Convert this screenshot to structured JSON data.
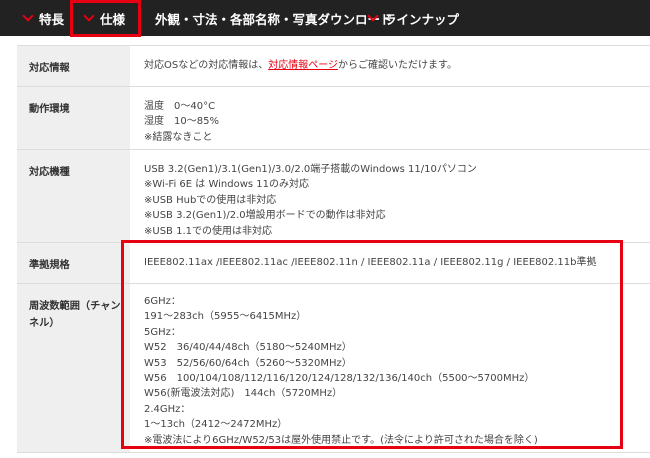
{
  "nav": {
    "tabs": [
      {
        "label": "特長"
      },
      {
        "label": "仕様"
      },
      {
        "label": "外観・寸法・各部名称・写真ダウンロード"
      },
      {
        "label": "ラインナップ"
      }
    ],
    "accent_color": "#e60012"
  },
  "spec": {
    "support": {
      "label": "対応情報",
      "text_before": "対応OSなどの対応情報は、",
      "link": "対応情報ページ",
      "text_after": "からご確認いただけます。"
    },
    "environment": {
      "label": "動作環境",
      "lines": [
        "温度　0～40°C",
        "湿度　10～85%",
        "※結露なきこと"
      ]
    },
    "devices": {
      "label": "対応機種",
      "lines": [
        "USB 3.2(Gen1)/3.1(Gen1)/3.0/2.0端子搭載のWindows 11/10パソコン",
        "※Wi-Fi 6E は Windows 11のみ対応",
        "※USB Hubでの使用は非対応",
        "※USB 3.2(Gen1)/2.0増設用ボードでの動作は非対応",
        "※USB 1.1での使用は非対応"
      ]
    },
    "standards": {
      "label": "準拠規格",
      "value": "IEEE802.11ax /IEEE802.11ac /IEEE802.11n / IEEE802.11a / IEEE802.11g / IEEE802.11b準拠"
    },
    "frequency": {
      "label": "周波数範囲（チャンネル）",
      "lines": [
        "6GHz：",
        "191～283ch（5955～6415MHz）",
        "5GHz：",
        "W52　36/40/44/48ch（5180～5240MHz）",
        "W53　52/56/60/64ch（5260～5320MHz）",
        "W56　100/104/108/112/116/120/124/128/132/136/140ch（5500～5700MHz）",
        "W56(新電波法対応)　144ch（5720MHz）",
        "2.4GHz：",
        "1～13ch（2412～2472MHz）",
        "※電波法により6GHz/W52/53は屋外使用禁止です。(法令により許可された場合を除く)"
      ]
    }
  }
}
